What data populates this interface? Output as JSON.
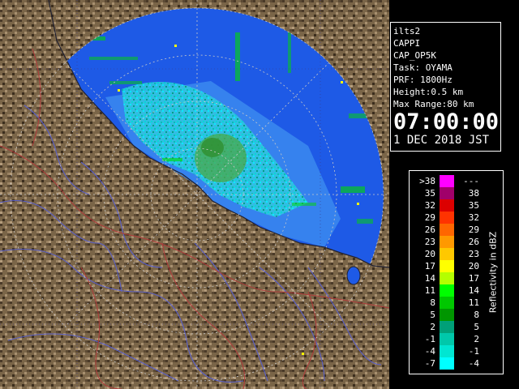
{
  "info": {
    "radar_id": "ilts2",
    "product": "CAPPI",
    "product_code": "CAP_OP5K",
    "task": "Task: OYAMA",
    "prf": "PRF: 1800Hz",
    "height": "Height:0.5 km",
    "max_range": "Max Range:80 km",
    "time": "07:00:00",
    "date": "1 DEC 2018 JST"
  },
  "legend": {
    "title": "Reflectivity in dBZ",
    "rows": [
      {
        "lo": ">38",
        "hi": "---",
        "color": "#ff00ff"
      },
      {
        "lo": "35",
        "hi": "38",
        "color": "#a0006a"
      },
      {
        "lo": "32",
        "hi": "35",
        "color": "#dc0000"
      },
      {
        "lo": "29",
        "hi": "32",
        "color": "#ff3300"
      },
      {
        "lo": "26",
        "hi": "29",
        "color": "#ff6600"
      },
      {
        "lo": "23",
        "hi": "26",
        "color": "#ff9900"
      },
      {
        "lo": "20",
        "hi": "23",
        "color": "#ffc800"
      },
      {
        "lo": "17",
        "hi": "20",
        "color": "#ffff00"
      },
      {
        "lo": "14",
        "hi": "17",
        "color": "#b4ff00"
      },
      {
        "lo": "11",
        "hi": "14",
        "color": "#00ff00"
      },
      {
        "lo": "8",
        "hi": "11",
        "color": "#00c800"
      },
      {
        "lo": "5",
        "hi": "8",
        "color": "#009600"
      },
      {
        "lo": "2",
        "hi": "5",
        "color": "#00a078"
      },
      {
        "lo": "-1",
        "hi": "2",
        "color": "#00c8aa"
      },
      {
        "lo": "-4",
        "hi": "-1",
        "color": "#00e6d2"
      },
      {
        "lo": "-7",
        "hi": "-4",
        "color": "#00ffff"
      }
    ]
  },
  "colors": {
    "sea": "#1e5ae6",
    "land": "#7a6548",
    "rivers": "#5a60c8",
    "borders": "#b03a3a",
    "range_rings": "#c8c8c8"
  }
}
